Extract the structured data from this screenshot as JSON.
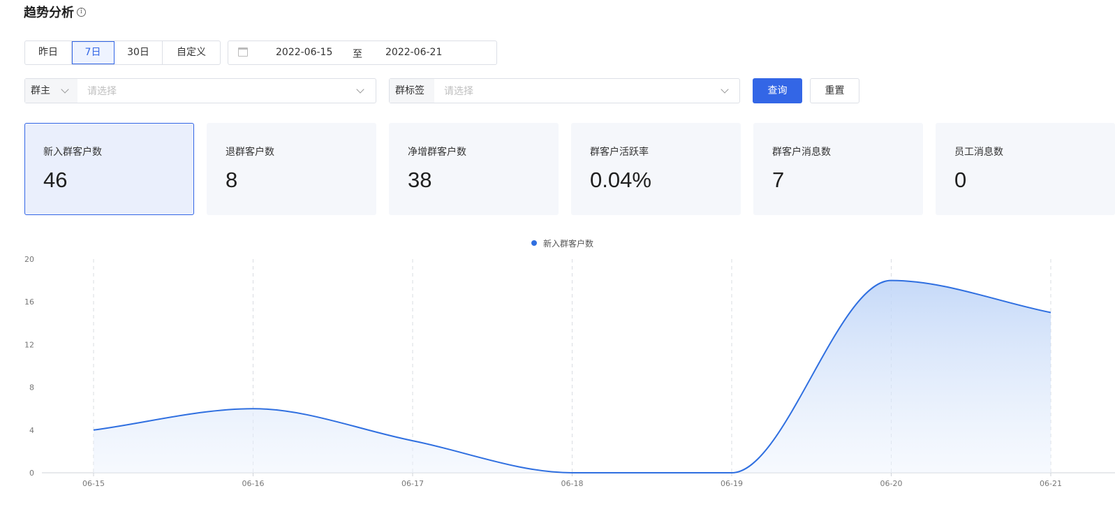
{
  "page": {
    "title": "趋势分析"
  },
  "period_tabs": [
    {
      "label": "昨日",
      "active": false
    },
    {
      "label": "7日",
      "active": true
    },
    {
      "label": "30日",
      "active": false
    },
    {
      "label": "自定义",
      "active": false
    }
  ],
  "date_range": {
    "start": "2022-06-15",
    "separator": "至",
    "end": "2022-06-21"
  },
  "filters": {
    "owner": {
      "label": "群主",
      "placeholder": "请选择"
    },
    "tag": {
      "label": "群标签",
      "placeholder": "请选择"
    }
  },
  "actions": {
    "query": "查询",
    "reset": "重置"
  },
  "metrics": [
    {
      "label": "新入群客户数",
      "value": "46",
      "active": true
    },
    {
      "label": "退群客户数",
      "value": "8",
      "active": false
    },
    {
      "label": "净增群客户数",
      "value": "38",
      "active": false
    },
    {
      "label": "群客户活跃率",
      "value": "0.04%",
      "active": false
    },
    {
      "label": "群客户消息数",
      "value": "7",
      "active": false
    },
    {
      "label": "员工消息数",
      "value": "0",
      "active": false
    }
  ],
  "colors": {
    "accent": "#3366e6",
    "line": "#2f6fe0"
  },
  "chart_data": {
    "type": "area",
    "categories": [
      "06-15",
      "06-16",
      "06-17",
      "06-18",
      "06-19",
      "06-20",
      "06-21"
    ],
    "series": [
      {
        "name": "新入群客户数",
        "values": [
          4,
          6,
          3,
          0,
          0,
          18,
          15
        ]
      }
    ],
    "ylim": [
      0,
      20
    ],
    "yticks": [
      0,
      4,
      8,
      12,
      16,
      20
    ],
    "grid": "vertical-dashed",
    "legend": "top-center",
    "smooth": true
  }
}
